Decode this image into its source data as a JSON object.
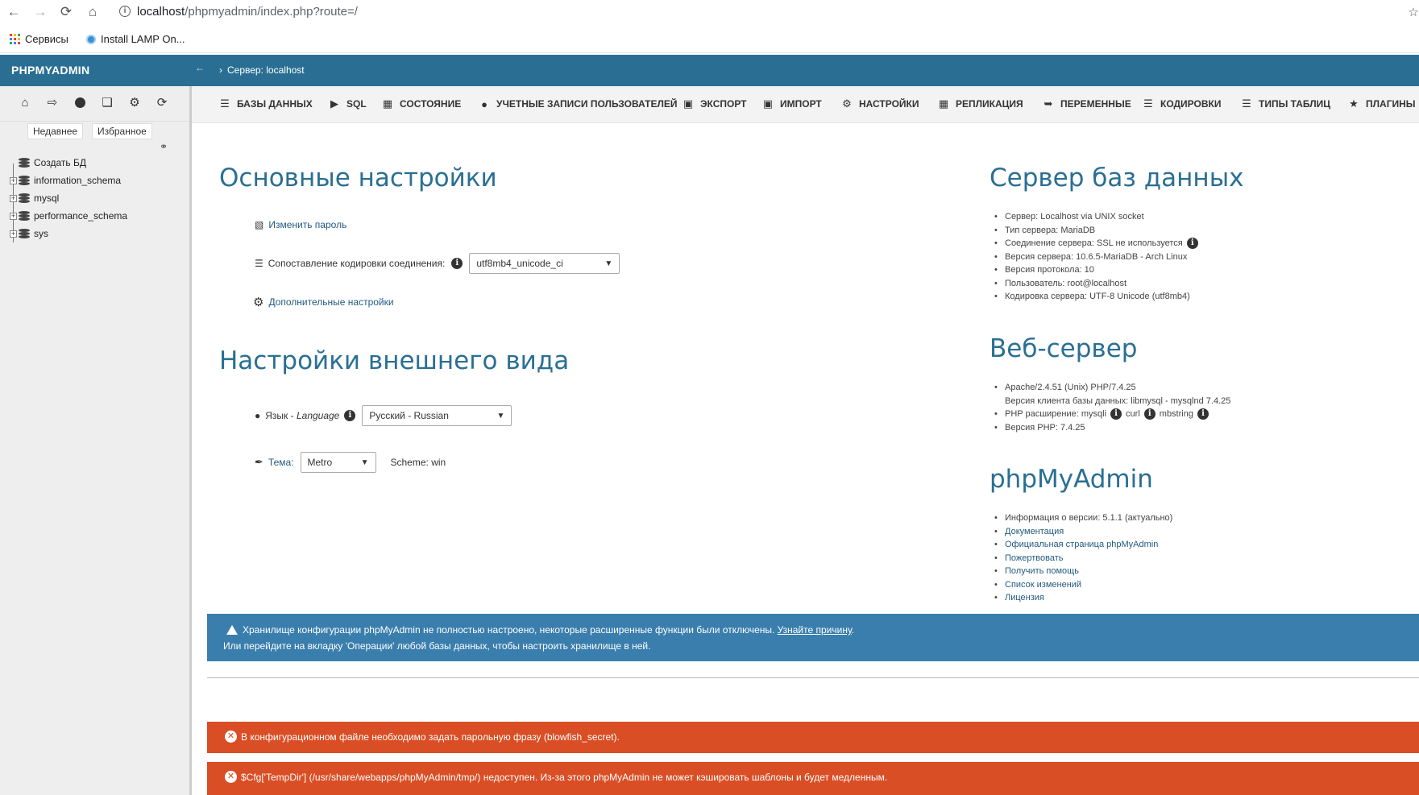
{
  "browser": {
    "url_host": "localhost",
    "url_path": "/phpmyadmin/index.php?route=/",
    "bookmarks": [
      {
        "label": "Сервисы",
        "icon": "apps-grid-icon"
      },
      {
        "label": "Install LAMP On...",
        "icon": "site-favicon"
      }
    ]
  },
  "header": {
    "logo": "PHPMYADMIN",
    "breadcrumb_sep": "›",
    "breadcrumb": "Сервер: localhost"
  },
  "sidebar": {
    "tabs": [
      "Недавнее",
      "Избранное"
    ],
    "tree": [
      {
        "label": "Создать БД",
        "expandable": false
      },
      {
        "label": "information_schema",
        "expandable": true
      },
      {
        "label": "mysql",
        "expandable": true
      },
      {
        "label": "performance_schema",
        "expandable": true
      },
      {
        "label": "sys",
        "expandable": true
      }
    ]
  },
  "topmenu": [
    {
      "label": "БАЗЫ ДАННЫХ",
      "icon": "database-icon"
    },
    {
      "label": "SQL",
      "icon": "sql-icon"
    },
    {
      "label": "СОСТОЯНИЕ",
      "icon": "status-icon"
    },
    {
      "label": "УЧЕТНЫЕ ЗАПИСИ ПОЛЬЗОВАТЕЛЕЙ",
      "icon": "users-icon"
    },
    {
      "label": "ЭКСПОРТ",
      "icon": "export-icon"
    },
    {
      "label": "ИМПОРТ",
      "icon": "import-icon"
    },
    {
      "label": "НАСТРОЙКИ",
      "icon": "settings-icon"
    },
    {
      "label": "РЕПЛИКАЦИЯ",
      "icon": "replication-icon"
    },
    {
      "label": "ПЕРЕМЕННЫЕ",
      "icon": "variables-icon"
    },
    {
      "label": "КОДИРОВКИ",
      "icon": "charset-icon"
    },
    {
      "label": "ТИПЫ ТАБЛИЦ",
      "icon": "engines-icon"
    },
    {
      "label": "ПЛАГИНЫ",
      "icon": "plugins-icon"
    }
  ],
  "general": {
    "title": "Основные настройки",
    "change_password": "Изменить пароль",
    "collation_label": "Сопоставление кодировки соединения:",
    "collation_value": "utf8mb4_unicode_ci",
    "more_settings": "Дополнительные настройки"
  },
  "appearance": {
    "title": "Настройки внешнего вида",
    "language_label": "Язык - ",
    "language_label_en": "Language",
    "language_value": "Русский - Russian",
    "theme_label": "Тема:",
    "theme_value": "Metro",
    "scheme": "Scheme: win"
  },
  "db_server": {
    "title": "Сервер баз данных",
    "items": [
      "Сервер: Localhost via UNIX socket",
      "Тип сервера: MariaDB",
      "Соединение сервера: SSL не используется",
      "Версия сервера: 10.6.5-MariaDB - Arch Linux",
      "Версия протокола: 10",
      "Пользователь: root@localhost",
      "Кодировка сервера: UTF-8 Unicode (utf8mb4)"
    ]
  },
  "web_server": {
    "title": "Веб-сервер",
    "apache": "Apache/2.4.51 (Unix) PHP/7.4.25",
    "client": "Версия клиента базы данных: libmysql - mysqlnd 7.4.25",
    "php_ext_label": "PHP расширение: mysqli",
    "php_ext_curl": "curl",
    "php_ext_mbstring": "mbstring",
    "php_version": "Версия PHP: 7.4.25"
  },
  "pma": {
    "title": "phpMyAdmin",
    "version": "Информация о версии: 5.1.1 (актуально)",
    "links": [
      "Документация",
      "Официальная страница phpMyAdmin",
      "Пожертвовать",
      "Получить помощь",
      "Список изменений",
      "Лицензия"
    ]
  },
  "notices": {
    "config_warning": "Хранилище конфигурации phpMyAdmin не полностью настроено, некоторые расширенные функции были отключены. ",
    "config_link": "Узнайте причину",
    "config_warning_end": ".",
    "config_line2": "Или перейдите на вкладку 'Операции' любой базы данных, чтобы настроить хранилище в ней.",
    "error_blowfish": "В конфигурационном файле необходимо задать парольную фразу (blowfish_secret).",
    "error_tempdir": "$Cfg['TempDir'] (/usr/share/webapps/phpMyAdmin/tmp/) недоступен. Из-за этого phpMyAdmin не может кэшировать шаблоны и будет медленным."
  },
  "colors": {
    "header_bg": "#2a6f93",
    "heading": "#2a6f93",
    "link": "#235a81",
    "notice_blue": "#3a7ead",
    "error_red": "#d94e25"
  }
}
